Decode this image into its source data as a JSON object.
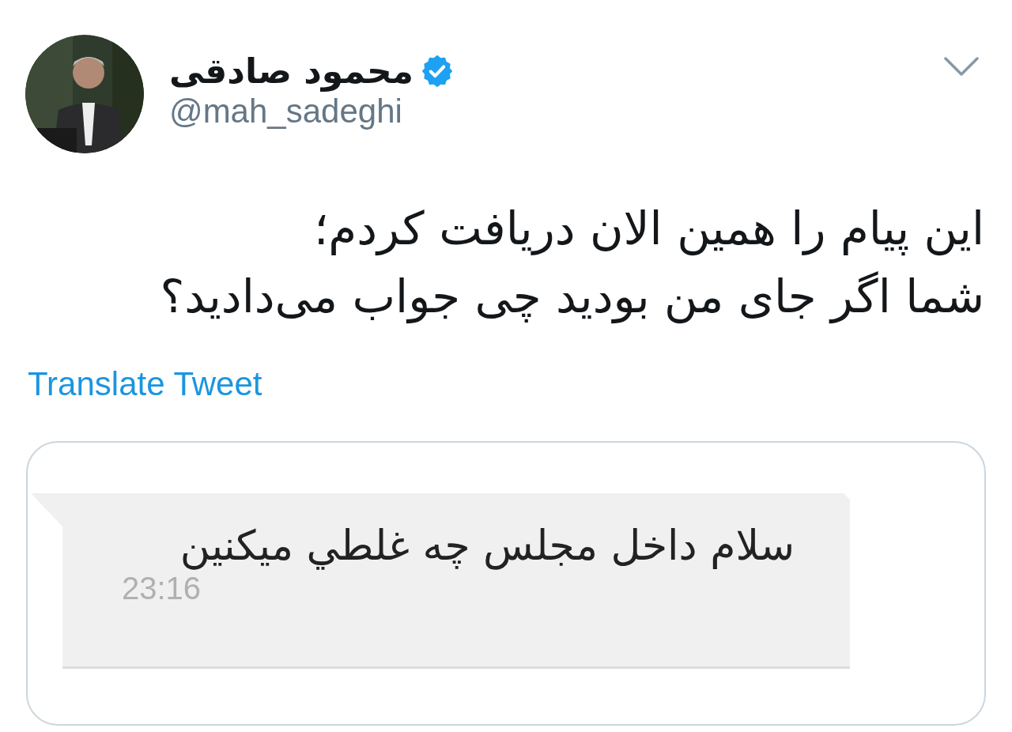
{
  "tweet": {
    "author": {
      "name": "محمود صادقی",
      "verified": true,
      "handle": "@mah_sadeghi"
    },
    "text_lines": [
      "این پیام را همین الان دریافت کردم؛",
      "شما اگر جای من بودید چی جواب می‌دادید؟"
    ],
    "translate_link": "Translate Tweet",
    "media": {
      "message": {
        "text": "سلام داخل مجلس چه غلطي ميكنين",
        "time": "23:16"
      }
    }
  }
}
